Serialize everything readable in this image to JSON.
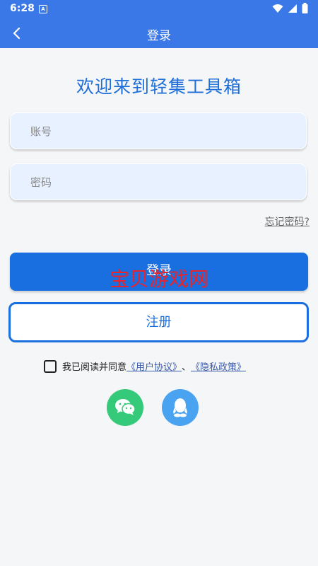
{
  "status_bar": {
    "time": "6:28",
    "badge": "A"
  },
  "app_bar": {
    "title": "登录"
  },
  "welcome": "欢迎来到轻集工具箱",
  "account_field": {
    "placeholder": "账号",
    "value": ""
  },
  "password_field": {
    "placeholder": "密码",
    "value": ""
  },
  "forgot_password": "忘记密码?",
  "login_button": "登录",
  "watermark": "宝贝游戏网",
  "register_button": "注册",
  "agreement": {
    "prefix": "我已阅读并同意",
    "user_agreement": "《用户协议》",
    "separator": "、",
    "privacy_policy": "《隐私政策》",
    "checked": false
  },
  "social_login": [
    {
      "name": "wechat-icon",
      "color": "#35c97a"
    },
    {
      "name": "qq-icon",
      "color": "#4aa3f0"
    }
  ],
  "colors": {
    "primary": "#3b78e7",
    "button": "#1a6fe0",
    "welcome": "#1f6fd8",
    "watermark": "#e8242a"
  }
}
